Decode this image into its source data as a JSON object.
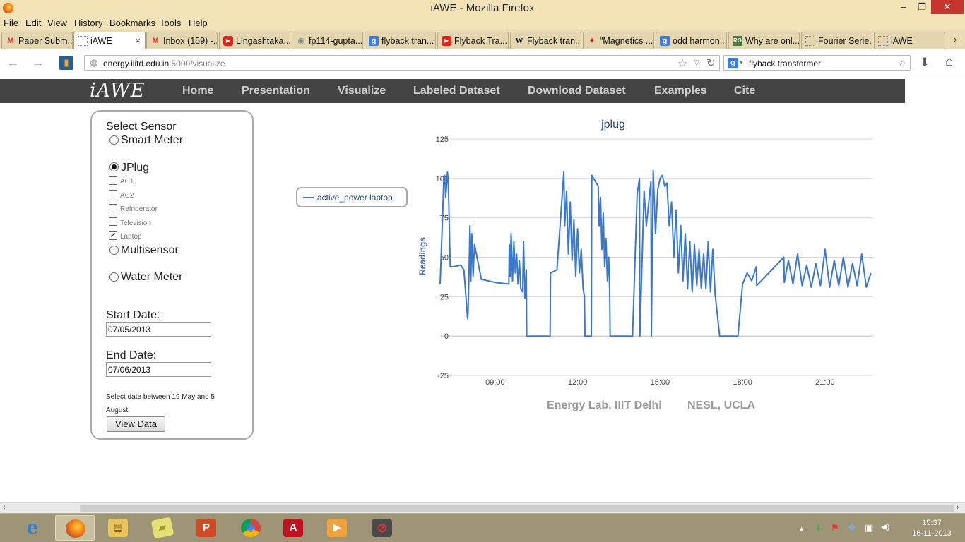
{
  "window": {
    "title": "iAWE - Mozilla Firefox",
    "min_label": "‒",
    "max_label": "❐",
    "close_label": "✕"
  },
  "menu": [
    "File",
    "Edit",
    "View",
    "History",
    "Bookmarks",
    "Tools",
    "Help"
  ],
  "tabs": [
    {
      "label": "Paper Subm...",
      "icon": "gmail-icon",
      "glyph": "M",
      "color": "#d93025"
    },
    {
      "label": "iAWE",
      "icon": "blank-page-icon",
      "glyph": "",
      "color": "#888888"
    },
    {
      "label": "Inbox (159) -...",
      "icon": "gmail-icon",
      "glyph": "M",
      "color": "#d93025"
    },
    {
      "label": "Lingashtaka...",
      "icon": "youtube-icon",
      "glyph": "▶",
      "color": "#e62117"
    },
    {
      "label": "fp114-gupta...",
      "icon": "document-icon",
      "glyph": "◉",
      "color": "#777777"
    },
    {
      "label": "flyback tran...",
      "icon": "google-icon",
      "glyph": "g",
      "color": "#3b7ae0"
    },
    {
      "label": "Flyback Tra...",
      "icon": "youtube-icon",
      "glyph": "▶",
      "color": "#e62117"
    },
    {
      "label": "Flyback tran...",
      "icon": "wikipedia-icon",
      "glyph": "W",
      "color": "#222222"
    },
    {
      "label": "\"Magnetics ...",
      "icon": "ti-logo-icon",
      "glyph": "✦",
      "color": "#c8102e"
    },
    {
      "label": "odd harmon...",
      "icon": "google-icon",
      "glyph": "g",
      "color": "#3b7ae0"
    },
    {
      "label": "Why are onl...",
      "icon": "researchgate-icon",
      "glyph": "RG",
      "color": "#4a7a3a"
    },
    {
      "label": "Fourier Serie...",
      "icon": "blank-page-icon",
      "glyph": "",
      "color": "#888888"
    },
    {
      "label": "iAWE",
      "icon": "blank-page-icon",
      "glyph": "",
      "color": "#888888"
    }
  ],
  "tab_close": "×",
  "tab_scroll": "›",
  "nav": {
    "back": "←",
    "forward": "→",
    "url_host": "energy.iiitd.edu.in",
    "url_rest": ":5000/visualize",
    "search_engine_glyph": "g",
    "search_value": "flyback transformer",
    "star": "☆",
    "url_drop": "▽",
    "reload": "↻",
    "search_drop": "▾",
    "magnifier": "⌕",
    "download": "⬇",
    "home": "⌂"
  },
  "site": {
    "brand": "iAWE",
    "links": [
      "Home",
      "Presentation",
      "Visualize",
      "Labeled Dataset",
      "Download Dataset",
      "Examples",
      "Cite"
    ]
  },
  "panel": {
    "heading": "Select Sensor",
    "smart_meter": "Smart Meter",
    "jplug": "JPlug",
    "appliances": [
      {
        "label": "AC1",
        "checked": false
      },
      {
        "label": "AC2",
        "checked": false
      },
      {
        "label": "Refrigerator",
        "checked": false
      },
      {
        "label": "Television",
        "checked": false
      },
      {
        "label": "Laptop",
        "checked": true
      }
    ],
    "multisensor": "Multisensor",
    "water_meter": "Water Meter",
    "selected_sensor": "JPlug",
    "start_label": "Start Date:",
    "start_value": "07/05/2013",
    "end_label": "End Date:",
    "end_value": "07/06/2013",
    "note_line1": "Select date between 19 May and 5",
    "note_line2": "August",
    "view_button": "View Data",
    "check_mark": "✓"
  },
  "legend": {
    "label": "active_power laptop",
    "color": "#3a78cf"
  },
  "chart_data": {
    "type": "line",
    "title": "jplug",
    "ylabel": "Readings",
    "ylim": [
      -25,
      125
    ],
    "yticks": [
      -25,
      0,
      25,
      50,
      75,
      100,
      125
    ],
    "xlim": [
      "07:00",
      "22:45"
    ],
    "xticks": [
      "09:00",
      "12:00",
      "15:00",
      "18:00",
      "21:00"
    ],
    "grid": true,
    "series": [
      {
        "name": "active_power laptop",
        "color": "#3a78cf",
        "x": [
          "07:00",
          "07:05",
          "07:08",
          "07:10",
          "07:12",
          "07:14",
          "07:16",
          "07:18",
          "07:22",
          "07:30",
          "07:45",
          "07:52",
          "08:00",
          "08:01",
          "08:03",
          "08:05",
          "08:07",
          "08:09",
          "08:12",
          "08:15",
          "08:30",
          "09:00",
          "09:30",
          "09:31",
          "09:33",
          "09:35",
          "09:38",
          "09:41",
          "09:44",
          "09:47",
          "09:50",
          "09:53",
          "09:56",
          "10:00",
          "10:02",
          "10:05",
          "10:08",
          "10:09",
          "11:00",
          "11:01",
          "11:15",
          "11:30",
          "11:32",
          "11:36",
          "11:40",
          "11:44",
          "11:48",
          "11:52",
          "11:56",
          "12:00",
          "12:04",
          "12:08",
          "12:12",
          "12:15",
          "12:16",
          "12:30",
          "12:31",
          "12:45",
          "12:47",
          "12:50",
          "12:53",
          "12:56",
          "12:59",
          "13:02",
          "13:05",
          "13:08",
          "13:10",
          "13:11",
          "14:00",
          "14:10",
          "14:15",
          "14:16",
          "14:25",
          "14:30",
          "14:40",
          "14:41",
          "14:45",
          "14:50",
          "14:55",
          "15:00",
          "15:05",
          "15:10",
          "15:15",
          "15:20",
          "15:25",
          "15:30",
          "15:35",
          "15:40",
          "15:45",
          "15:50",
          "15:55",
          "16:00",
          "16:05",
          "16:10",
          "16:15",
          "16:20",
          "16:25",
          "16:30",
          "16:35",
          "16:40",
          "16:45",
          "16:50",
          "16:55",
          "17:00",
          "17:10",
          "17:20",
          "17:30",
          "17:40",
          "17:50",
          "18:00",
          "18:10",
          "18:20",
          "18:30",
          "18:31",
          "19:30",
          "19:31",
          "19:40",
          "19:50",
          "20:00",
          "20:10",
          "20:20",
          "20:30",
          "20:40",
          "20:50",
          "21:00",
          "21:10",
          "21:20",
          "21:30",
          "21:40",
          "21:50",
          "22:00",
          "22:10",
          "22:20",
          "22:30",
          "22:40"
        ],
        "y": [
          33,
          72,
          100,
          102,
          88,
          95,
          104,
          96,
          44,
          44,
          45,
          42,
          11,
          15,
          40,
          70,
          35,
          65,
          38,
          58,
          36,
          34,
          33,
          58,
          38,
          65,
          35,
          60,
          40,
          52,
          33,
          48,
          30,
          28,
          60,
          24,
          42,
          0,
          0,
          40,
          42,
          104,
          70,
          92,
          52,
          85,
          48,
          74,
          38,
          68,
          40,
          55,
          30,
          25,
          0,
          0,
          102,
          95,
          70,
          88,
          55,
          78,
          44,
          62,
          35,
          50,
          28,
          0,
          0,
          90,
          100,
          0,
          92,
          70,
          98,
          0,
          105,
          65,
          93,
          100,
          102,
          95,
          97,
          70,
          85,
          50,
          80,
          40,
          70,
          35,
          65,
          30,
          60,
          28,
          58,
          32,
          55,
          30,
          52,
          30,
          60,
          28,
          55,
          27,
          0,
          0,
          0,
          0,
          0,
          33,
          40,
          35,
          44,
          32,
          50,
          34,
          48,
          33,
          52,
          32,
          45,
          31,
          46,
          32,
          55,
          31,
          48,
          32,
          50,
          31,
          46,
          32,
          52,
          31,
          40
        ]
      }
    ]
  },
  "credits": [
    "Energy Lab, IIIT Delhi",
    "NESL, UCLA"
  ],
  "scroll": {
    "left": "‹",
    "right": "›"
  },
  "taskbar": {
    "items": [
      {
        "icon": "internet-explorer-icon",
        "glyph": "e",
        "color": "#2d7fd1"
      },
      {
        "icon": "firefox-icon",
        "glyph": "",
        "color": "#e8630e"
      },
      {
        "icon": "file-explorer-icon",
        "glyph": "▤",
        "color": "#e9c45a"
      },
      {
        "icon": "sticky-notes-icon",
        "glyph": "▰",
        "color": "#d9d35a"
      },
      {
        "icon": "powerpoint-icon",
        "glyph": "P",
        "color": "#d04a27"
      },
      {
        "icon": "chrome-icon",
        "glyph": "◉",
        "color": "#2f9a48"
      },
      {
        "icon": "adobe-reader-icon",
        "glyph": "A",
        "color": "#c1121f"
      },
      {
        "icon": "media-player-icon",
        "glyph": "▶",
        "color": "#f0a33a"
      },
      {
        "icon": "app-icon",
        "glyph": "⊘",
        "color": "#b22222"
      }
    ],
    "tray": [
      "▲",
      "⬇",
      "⚑",
      "❖",
      "▣",
      "◀)"
    ],
    "time": "15:37",
    "date": "16-11-2013"
  }
}
